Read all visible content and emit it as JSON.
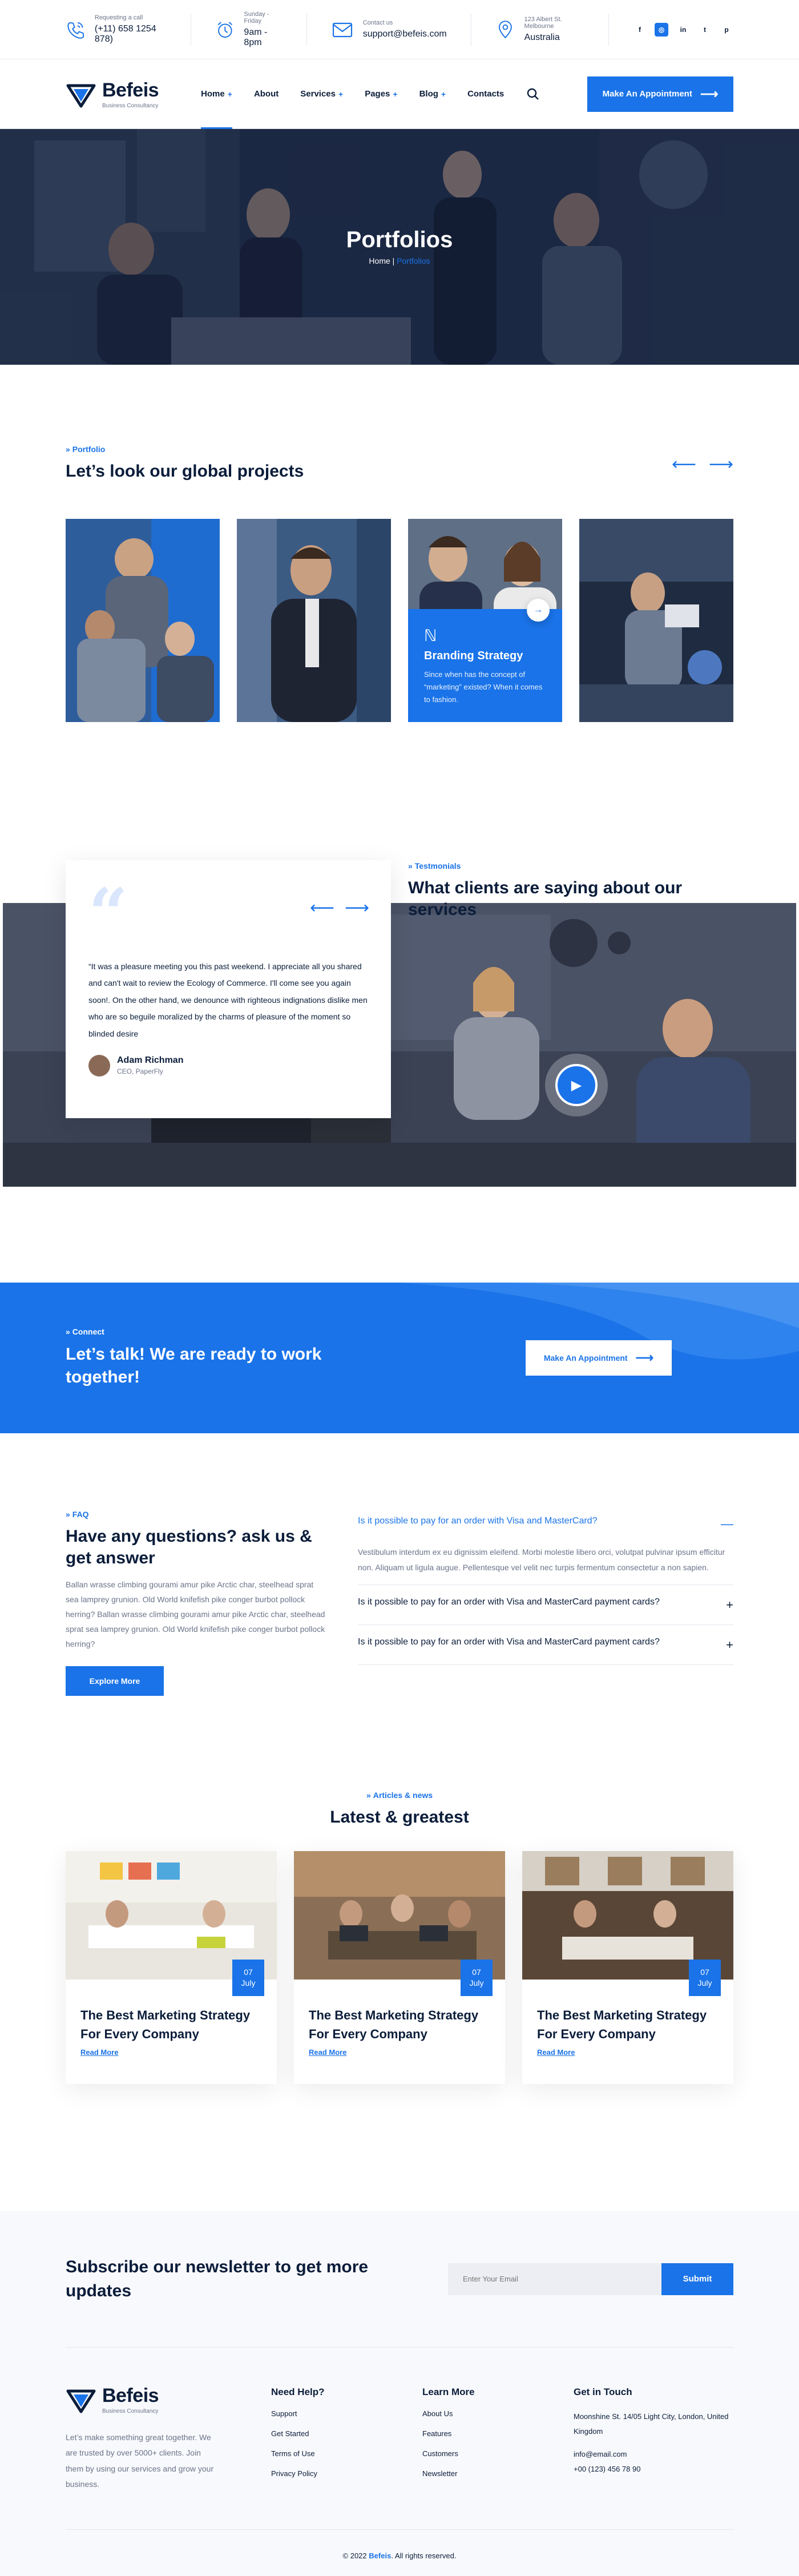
{
  "topbar": {
    "call": {
      "label": "Requesting a call",
      "value": "(+11) 658 1254 878)"
    },
    "hours": {
      "label": "Sunday - Friday",
      "value": "9am - 8pm"
    },
    "contact": {
      "label": "Contact us",
      "value": "support@befeis.com"
    },
    "address": {
      "label": "123 Albert St. Melbourne",
      "value": "Australia"
    },
    "social": [
      "f",
      "◎",
      "in",
      "t",
      "p"
    ]
  },
  "header": {
    "logo": {
      "name": "Befeis",
      "tagline": "Business Consultancy"
    },
    "nav": [
      {
        "label": "Home",
        "plus": "+"
      },
      {
        "label": "About",
        "plus": ""
      },
      {
        "label": "Services",
        "plus": "+"
      },
      {
        "label": "Pages",
        "plus": "+"
      },
      {
        "label": "Blog",
        "plus": "+"
      },
      {
        "label": "Contacts",
        "plus": ""
      }
    ],
    "cta": "Make An Appointment"
  },
  "hero": {
    "title": "Portfolios",
    "crumb_home": "Home",
    "crumb_sep": "|",
    "crumb_current": "Portfolios"
  },
  "portfolio": {
    "label": "Portfolio",
    "title": "Let’s look our global projects",
    "featured": {
      "title": "Branding Strategy",
      "text": "Since when has the concept of “marketing” existed? When it comes to fashion."
    }
  },
  "testimonials": {
    "label": "Testmonials",
    "title": "What clients are saying about our services",
    "quote": "“It was a pleasure meeting you this past weekend. I appreciate all you shared and can't wait to review the Ecology of Commerce. I'll come see you again soon!. On the other hand, we denounce with righteous indignations dislike men who are so beguile moralized by the charms of pleasure of the moment so blinded desire",
    "author": "Adam Richman",
    "role": "CEO, PaperFly"
  },
  "connect": {
    "label": "Connect",
    "title": "Let’s talk! We are ready to work together!",
    "button": "Make An Appointment"
  },
  "faq": {
    "label": "FAQ",
    "title": "Have any questions? ask us & get answer",
    "desc": "Ballan wrasse climbing gourami amur pike Arctic char, steelhead sprat sea lamprey grunion. Old World knifefish pike conger burbot pollock herring? Ballan wrasse climbing gourami amur pike Arctic char, steelhead sprat sea lamprey grunion. Old World knifefish pike conger burbot pollock herring?",
    "button": "Explore More",
    "items": [
      {
        "q": "Is it possible to pay for an order with Visa and MasterCard?",
        "a": "Vestibulum interdum ex eu dignissim eleifend. Morbi molestie libero orci, volutpat pulvinar ipsum efficitur non. Aliquam ut ligula augue. Pellentesque vel velit nec turpis fermentum consectetur a non sapien.",
        "toggle": "—"
      },
      {
        "q": "Is it possible to pay for an order with Visa and MasterCard payment cards?",
        "toggle": "+"
      },
      {
        "q": "Is it possible to pay for an order with Visa and MasterCard payment cards?",
        "toggle": "+"
      }
    ]
  },
  "blog": {
    "label": "Articles & news",
    "title": "Latest & greatest",
    "posts": [
      {
        "day": "07",
        "month": "July",
        "title": "The Best Marketing Strategy For Every Company",
        "link": "Read More"
      },
      {
        "day": "07",
        "month": "July",
        "title": "The Best Marketing Strategy For Every Company",
        "link": "Read More"
      },
      {
        "day": "07",
        "month": "July",
        "title": "The Best Marketing Strategy For Every Company",
        "link": "Read More"
      }
    ]
  },
  "footer": {
    "newsletter_title": "Subscribe our newsletter to get more updates",
    "email_placeholder": "Enter Your Email",
    "submit": "Submit",
    "about": "Let’s make something great together. We are trusted by over 5000+ clients. Join them by using our services and grow your business.",
    "col_help": {
      "title": "Need Help?",
      "links": [
        "Support",
        "Get Started",
        "Terms of Use",
        "Privacy Policy"
      ]
    },
    "col_learn": {
      "title": "Learn More",
      "links": [
        "About Us",
        "Features",
        "Customers",
        "Newsletter"
      ]
    },
    "col_touch": {
      "title": "Get in Touch",
      "address": "Moonshine St. 14/05 Light City, London, United Kingdom",
      "email": "info@email.com",
      "phone": "+00 (123) 456 78 90"
    },
    "copy_pre": "© 2022",
    "copy_brand": "Befeis",
    "copy_post": ". All rights reserved."
  },
  "colors": {
    "accent": "#1a73e8",
    "dark": "#0b1d3a",
    "muted": "#6b7489"
  }
}
